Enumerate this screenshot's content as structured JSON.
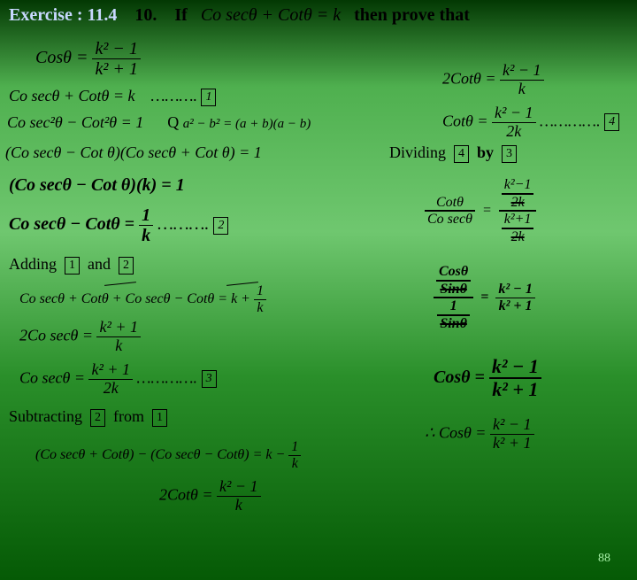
{
  "header": {
    "exercise": "Exercise : 11.4",
    "qnum": "10.",
    "word_if": "If",
    "premise": "Co secθ + Cotθ = k",
    "then": "then prove that"
  },
  "target": {
    "lhs": "Cosθ =",
    "num": "k² − 1",
    "den": "k² + 1"
  },
  "l1": {
    "expr": "Co secθ + Cotθ = k",
    "dots": "……….",
    "box": "1"
  },
  "l2": {
    "expr": "Co sec²θ − Cot²θ = 1",
    "qmark": "Q",
    "identity": "a² − b² = (a + b)(a − b)"
  },
  "l3": "(Co secθ − Cot θ)(Co secθ + Cot θ) = 1",
  "l4": "(Co secθ − Cot θ)(k) = 1",
  "l5": {
    "lhs": "Co secθ − Cotθ =",
    "num": "1",
    "den": "k",
    "dots": "……….",
    "box": "2"
  },
  "adding": {
    "label": "Adding",
    "a": "1",
    "word": "and",
    "b": "2"
  },
  "l6a": "Co secθ + Cotθ + Co secθ − Cotθ = k +",
  "l6a_frac": {
    "num": "1",
    "den": "k"
  },
  "l6b": {
    "lhs": "2Co secθ =",
    "num": "k² + 1",
    "den": "k"
  },
  "l6c": {
    "lhs": "Co secθ =",
    "num": "k² + 1",
    "den": "2k",
    "dots": "………….",
    "box": "3"
  },
  "subtract": {
    "label": "Subtracting",
    "a": "2",
    "word": "from",
    "b": "1"
  },
  "l7a": "(Co secθ + Cotθ) − (Co secθ − Cotθ) = k −",
  "l7a_frac": {
    "num": "1",
    "den": "k"
  },
  "l7b": {
    "lhs": "2Cotθ =",
    "num": "k² − 1",
    "den": "k"
  },
  "r1": {
    "lhs": "2Cotθ =",
    "num": "k² − 1",
    "den": "k"
  },
  "r2": {
    "lhs": "Cotθ =",
    "num": "k² − 1",
    "den": "2k",
    "dots": "………….",
    "box": "4"
  },
  "dividing": {
    "label": "Dividing",
    "a": "4",
    "word": "by",
    "b": "3"
  },
  "r3": {
    "lnum": "Cotθ",
    "lden": "Co secθ",
    "rnumnum": "k²−1",
    "rnumden": "2k",
    "rdennum": "k²+1",
    "rdenden": "2k"
  },
  "r4": {
    "lnum": "Cosθ",
    "lmid": "Sinθ",
    "lden": "1",
    "lden2": "Sinθ",
    "rnum": "k² − 1",
    "rden": "k² + 1"
  },
  "r5": {
    "lhs": "Cosθ =",
    "num": "k² − 1",
    "den": "k² + 1"
  },
  "r6": {
    "lhs": "∴  Cosθ =",
    "num": "k² − 1",
    "den": "k² + 1"
  },
  "page": "88"
}
